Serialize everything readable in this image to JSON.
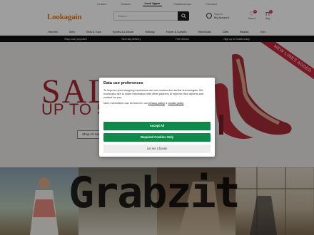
{
  "topstrip": [
    "Lenses",
    "Simaris",
    "Look Again",
    "Kaleidoscope",
    "Curvissa"
  ],
  "topstrip_active": 2,
  "logo": {
    "main": "Lookagain"
  },
  "search": {
    "placeholder": "Search"
  },
  "account": {
    "line1": "Sign in",
    "line2": "My Account"
  },
  "icons": [
    {
      "name": "heart-icon",
      "glyph": "♡",
      "label": "Saved",
      "badge": "0"
    },
    {
      "name": "bag-icon",
      "glyph": "⊓",
      "label": "Bag",
      "badge": "0"
    }
  ],
  "nav": [
    "Women",
    "Men",
    "Kids & Toys",
    "Sports & Leisure",
    "Home & Garden",
    "Electricals",
    "Gifts",
    "Beauty",
    "Sale"
  ],
  "nav_extra": "Holiday",
  "promo": [
    "Shop now, pay later!",
    "Next day delivery",
    "Free returns",
    "Sign up to emails today"
  ],
  "hero": {
    "headline": "SALE",
    "subline": "UP TO 50%",
    "shop_all": "Shop All Sale",
    "ribbon": "NEW LINES ADDED"
  },
  "watermark": "Grabzit",
  "modal": {
    "title": "Data use preferences",
    "body": "To improve your shopping experience we use cookies and similar technologies. We would also like to share information with other partners to improve their adverts and content for you.",
    "more_prefix": "More information can be found in our",
    "privacy_link": "privacy policy",
    "amp": "&",
    "cookie_link": "cookie policy",
    "accept_all": "Accept All",
    "required_only": "Required Cookies Only",
    "let_me_choose": "Let me Choose"
  },
  "colors": {
    "logo": "#d8762a",
    "sale": "#a3262f",
    "accept": "#0f8a4b",
    "ribbon": "#c3263b"
  }
}
